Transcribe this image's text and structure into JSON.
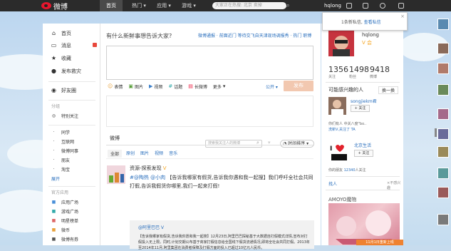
{
  "topbar": {
    "logo_text": "微博",
    "nav": [
      "首页",
      "热门",
      "应用",
      "游戏"
    ],
    "search_placeholder": "大家正在热搜: 北京 卖掉",
    "username": "hqlong"
  },
  "popup": {
    "prefix": "1条新私信,",
    "link": "查看私信",
    "close": "×"
  },
  "left": {
    "items": [
      {
        "label": "首页",
        "icon": "home-icon"
      },
      {
        "label": "消息",
        "icon": "message-icon"
      },
      {
        "label": "收藏",
        "icon": "star-icon"
      },
      {
        "label": "发布救灾",
        "icon": "disaster-icon"
      },
      {
        "label": "好友圈",
        "icon": "friends-icon"
      }
    ],
    "group_label": "分组",
    "group_items": [
      "特别关注"
    ],
    "list_items": [
      "同学",
      "互联网",
      "微博同事",
      "朋友",
      "淘宝"
    ],
    "expand_label": "展开",
    "app_label": "官方应用",
    "app_items": [
      "应用广场",
      "游戏广场",
      "明星榜单",
      "微币",
      "微博有券"
    ]
  },
  "publisher": {
    "prompt": "有什么新鲜事想告诉大家?",
    "links": "微博通报 · 前面近门 等待交飞自天津现场调报秀 · 热门 职博",
    "tools": [
      "表情",
      "图片",
      "视频",
      "话题",
      "长微博",
      "更多"
    ],
    "scope": "公开",
    "submit": "发布"
  },
  "feed": {
    "title": "微博",
    "search_placeholder": "搜索我关注人的微博",
    "sort": "时间排序",
    "tabs": [
      "全部",
      "原创",
      "图片",
      "视频",
      "音乐"
    ]
  },
  "post": {
    "author": "资源-探索发现",
    "author_v": "V",
    "mentions": "#@陶热 @小肉",
    "text": "【告诉我哪家有假货,告诉我你遇和我一起搜】我们呼吁全社会共同打假,告诉我假货你哪里,我们一起来打假!",
    "repost_head": "@阿里巴巴 V",
    "repost_body": "【告诉我哪家有假货,告诉我你愿和我一起搜】12月23日,阿里巴巴探秘基于大数据自打假模式详情,宣布对打假投入无上限。同时,计划交期公布基于商家打假信息给全国线下假货流通情况,即将全社会共同打假。2013年至2014年11月,阿里集团在消费者保障及打假方面的投入已超过10亿元人民币。"
  },
  "right": {
    "name": "hqlong",
    "vip": "V 会",
    "stats": [
      {
        "n": "1356",
        "l": "关注"
      },
      {
        "n": "1498",
        "l": "粉丝"
      },
      {
        "n": "9418",
        "l": "微博"
      }
    ],
    "rec_title": "可能感兴趣的人",
    "rec_swap": "换一换",
    "rec_name": "songjiekm君",
    "follow": "+ 关注",
    "rec_desc_1": "你们有人 中关八度\"bo..",
    "rec_desc_2": "洗新V,关注了 TA",
    "loc_name": "北京生活",
    "loc_desc_prefix": "你的朋友 ",
    "loc_desc_highlight": "12340",
    "loc_desc_suffix": "人关注",
    "rec_more": "找人",
    "rec_close": "×不感兴趣",
    "ad_title": "AMOYO魔物",
    "ad_bottom": "11月1日重新上线"
  }
}
